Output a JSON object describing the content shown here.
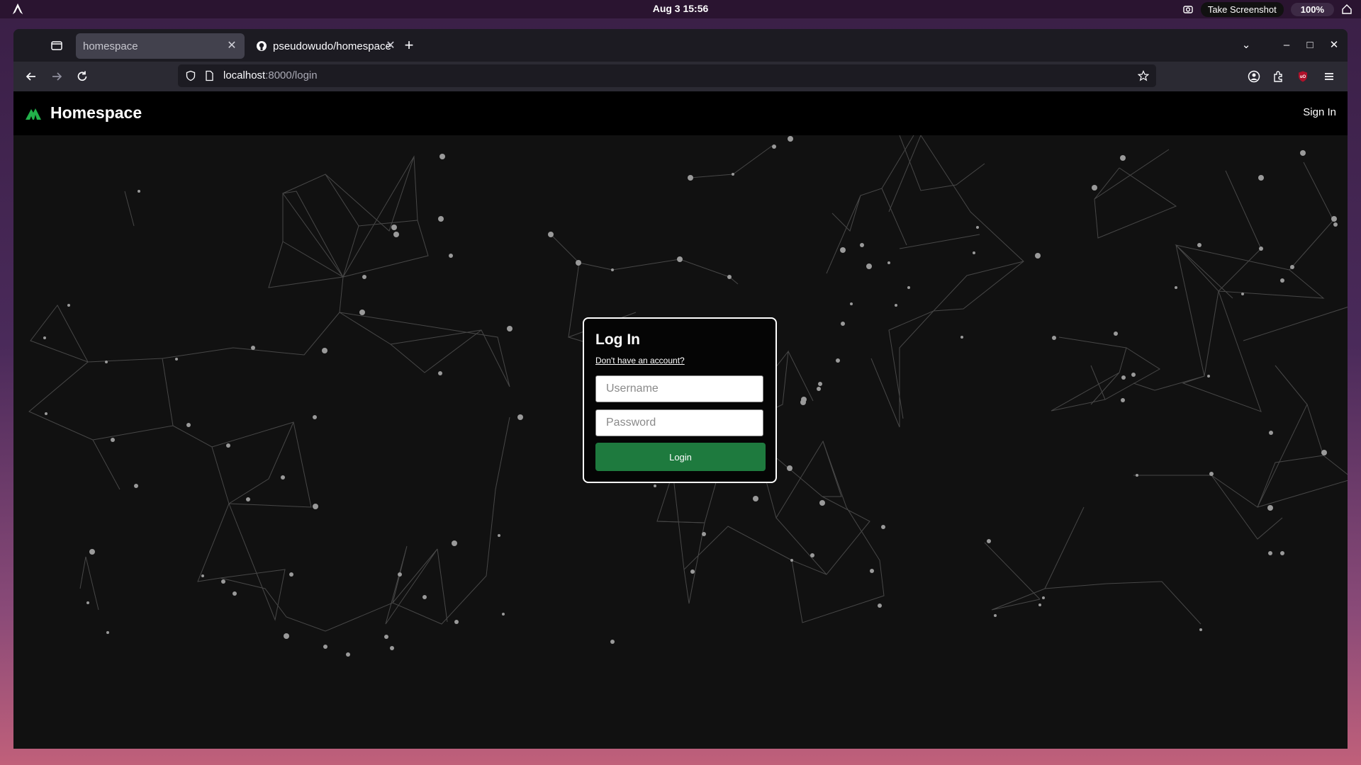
{
  "os": {
    "clock": "Aug 3  15:56",
    "tooltip": "Take Screenshot",
    "battery": "100%"
  },
  "browser": {
    "tabs": [
      {
        "label": "homespace",
        "active": true
      },
      {
        "label": "pseudowudo/homespace",
        "active": false,
        "icon": "github-icon"
      }
    ],
    "url_host": "localhost",
    "url_path": ":8000/login"
  },
  "site": {
    "brand": "Homespace",
    "brand_color": "#22b04a",
    "nav_signin": "Sign In"
  },
  "login": {
    "title": "Log In",
    "signup_link": "Don't have an account?",
    "username_placeholder": "Username",
    "password_placeholder": "Password",
    "button_label": "Login",
    "button_color": "#1e7a3e"
  }
}
